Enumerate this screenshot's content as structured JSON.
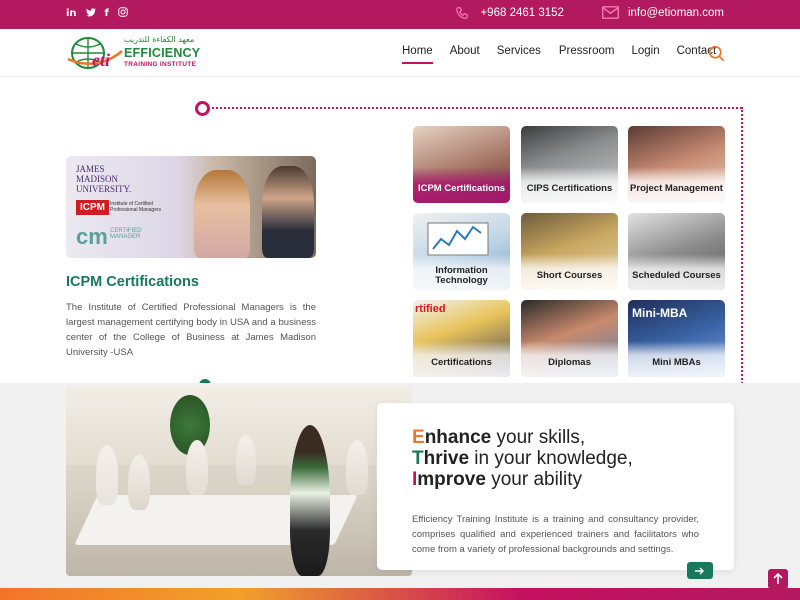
{
  "topbar": {
    "social": [
      "in",
      "t",
      "f",
      "ig"
    ],
    "phone": "+968 2461 3152",
    "email": "info@etioman.com",
    "color": "#b3195f"
  },
  "header": {
    "logo_arabic": "معهد الكفاءة للتدريب",
    "logo_name": "EFFICIENCY",
    "logo_sub": "TRAINING INSTITUTE",
    "logo_mark": "eti",
    "nav": [
      {
        "label": "Home",
        "active": true
      },
      {
        "label": "About",
        "active": false
      },
      {
        "label": "Services",
        "active": false
      },
      {
        "label": "Pressroom",
        "active": false
      },
      {
        "label": "Login",
        "active": false
      },
      {
        "label": "Contact",
        "active": false
      }
    ]
  },
  "featured": {
    "image_text": {
      "jmu": "JAMES MADISON UNIVERSITY.",
      "icpm": "ICPM",
      "icpm_sub": "Institute of Certified Professional Managers",
      "cm": "cm",
      "cm_sub": "CERTIFIED MANAGER"
    },
    "title": "ICPM Certifications",
    "description": "The Institute of Certified Professional Managers is the largest management certifying body in USA and a business center of the College of Business at James Madison University -USA"
  },
  "tiles": [
    {
      "label": "ICPM Certifications",
      "active": true
    },
    {
      "label": "CIPS Certifications",
      "active": false
    },
    {
      "label": "Project Management",
      "active": false
    },
    {
      "label": "Information Technology",
      "active": false
    },
    {
      "label": "Short Courses",
      "active": false
    },
    {
      "label": "Scheduled Courses",
      "active": false
    },
    {
      "label": "Certifications",
      "active": false
    },
    {
      "label": "Diplomas",
      "active": false
    },
    {
      "label": "Mini MBAs",
      "active": false
    }
  ],
  "tile_overlays": {
    "certified": "rtified",
    "mini_mba": "Mini-MBA"
  },
  "tagline": [
    {
      "initial": "E",
      "initial_color": "#f2742a",
      "bold": "nhance",
      "rest": " your skills,"
    },
    {
      "initial": "T",
      "initial_color": "#16795a",
      "bold": "hrive",
      "rest": " in your knowledge,"
    },
    {
      "initial": "I",
      "initial_color": "#c4125f",
      "bold": "mprove",
      "rest": " your ability"
    }
  ],
  "intro": "Efficiency Training Institute is a training and consultancy provider, comprises qualified and experienced trainers and facilitators who come from a variety of professional backgrounds and settings.",
  "accent": "#c4125f",
  "green": "#16795a"
}
